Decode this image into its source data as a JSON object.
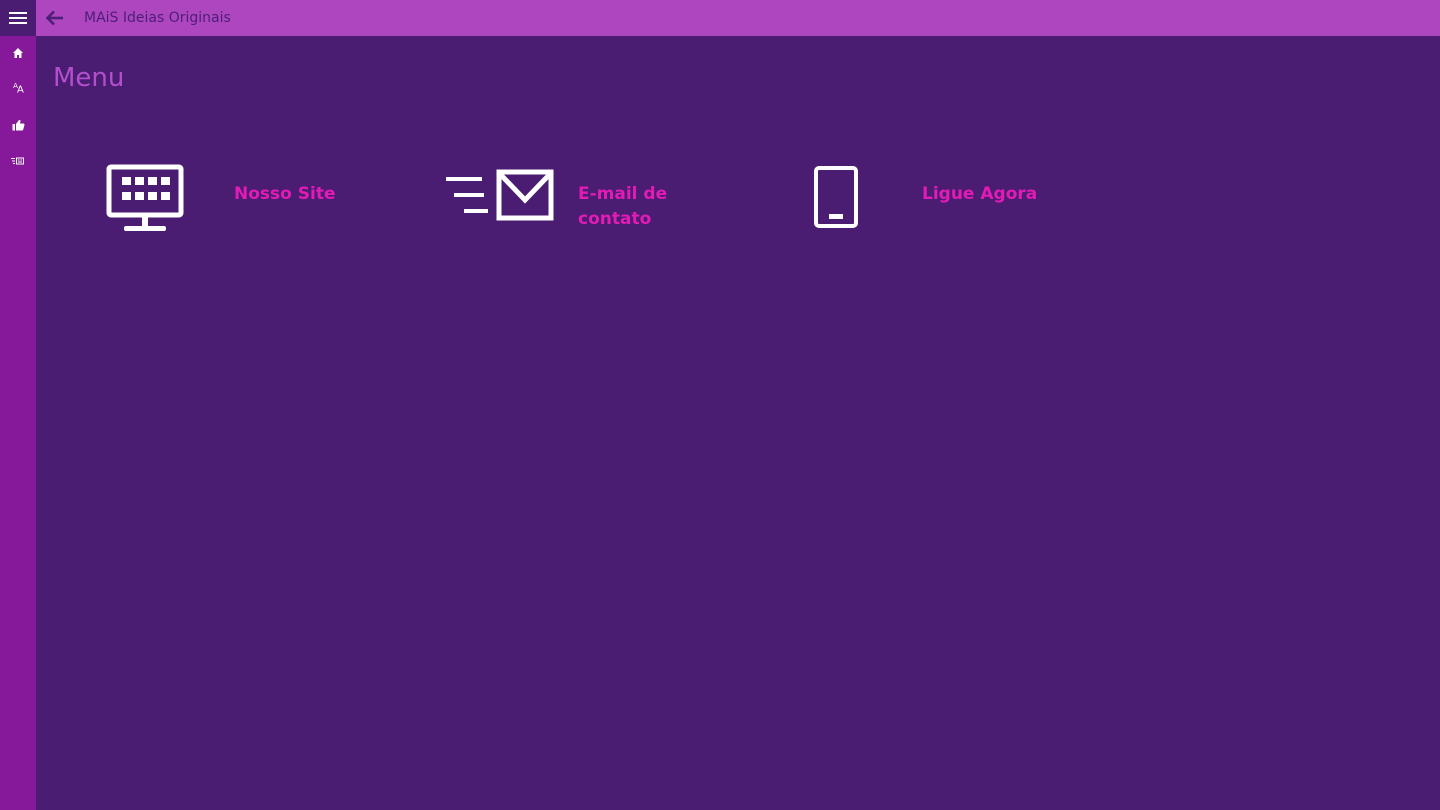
{
  "app": {
    "title": "MAiS Ideias Originais"
  },
  "sidebar": {
    "items": [
      {
        "name": "home",
        "icon": "home-icon"
      },
      {
        "name": "font-size",
        "icon": "font-size-icon"
      },
      {
        "name": "like",
        "icon": "thumbs-up-icon"
      },
      {
        "name": "news",
        "icon": "news-icon"
      }
    ]
  },
  "page": {
    "title": "Menu"
  },
  "menu": {
    "items": [
      {
        "label": "Nosso Site",
        "icon": "monitor-icon"
      },
      {
        "label": "E-mail de contato",
        "icon": "email-fast-icon"
      },
      {
        "label": "Ligue Agora",
        "icon": "phone-icon"
      }
    ]
  },
  "colors": {
    "background": "#4a1c72",
    "sidebar": "#86199a",
    "topbar": "#ae46c0",
    "page_title": "#b34fcc",
    "tile_label": "#e21bb5",
    "icon": "#ffffff"
  }
}
